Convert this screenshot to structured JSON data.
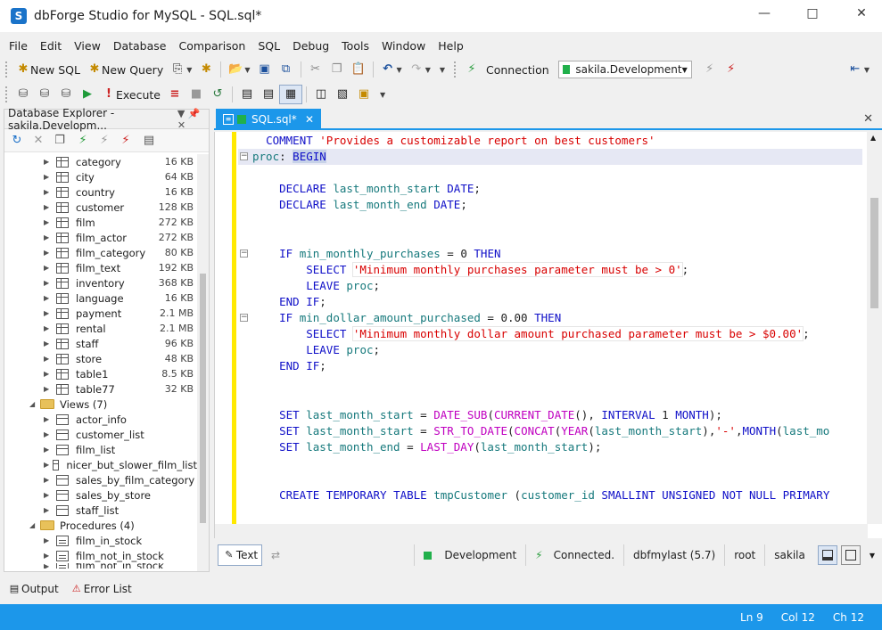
{
  "window": {
    "title": "dbForge Studio for MySQL - SQL.sql*",
    "logo": "S"
  },
  "menu": [
    "File",
    "Edit",
    "View",
    "Database",
    "Comparison",
    "SQL",
    "Debug",
    "Tools",
    "Window",
    "Help"
  ],
  "toolbar1": {
    "new_sql": "New SQL",
    "new_query": "New Query",
    "connection_label": "Connection",
    "connection_value": "sakila.Development"
  },
  "toolbar2": {
    "execute": "Execute"
  },
  "explorer": {
    "title": "Database Explorer - sakila.Developm...",
    "tables": [
      {
        "name": "category",
        "size": "16 KB"
      },
      {
        "name": "city",
        "size": "64 KB"
      },
      {
        "name": "country",
        "size": "16 KB"
      },
      {
        "name": "customer",
        "size": "128 KB"
      },
      {
        "name": "film",
        "size": "272 KB"
      },
      {
        "name": "film_actor",
        "size": "272 KB"
      },
      {
        "name": "film_category",
        "size": "80 KB"
      },
      {
        "name": "film_text",
        "size": "192 KB"
      },
      {
        "name": "inventory",
        "size": "368 KB"
      },
      {
        "name": "language",
        "size": "16 KB"
      },
      {
        "name": "payment",
        "size": "2.1 MB"
      },
      {
        "name": "rental",
        "size": "2.1 MB"
      },
      {
        "name": "staff",
        "size": "96 KB"
      },
      {
        "name": "store",
        "size": "48 KB"
      },
      {
        "name": "table1",
        "size": "8.5 KB"
      },
      {
        "name": "table77",
        "size": "32 KB"
      }
    ],
    "views_folder": "Views (7)",
    "views": [
      "actor_info",
      "customer_list",
      "film_list",
      "nicer_but_slower_film_list",
      "sales_by_film_category",
      "sales_by_store",
      "staff_list"
    ],
    "procedures_folder": "Procedures (4)",
    "procedures": [
      "film_in_stock",
      "film_not_in_stock"
    ]
  },
  "editor": {
    "tab_label": "SQL.sql*",
    "lines": [
      "  COMMENT 'Provides a customizable report on best customers'",
      "proc: BEGIN",
      "",
      "    DECLARE last_month_start DATE;",
      "    DECLARE last_month_end DATE;",
      "",
      "",
      "    IF min_monthly_purchases = 0 THEN",
      "        SELECT 'Minimum monthly purchases parameter must be > 0';",
      "        LEAVE proc;",
      "    END IF;",
      "    IF min_dollar_amount_purchased = 0.00 THEN",
      "        SELECT 'Minimum monthly dollar amount purchased parameter must be > $0.00';",
      "        LEAVE proc;",
      "    END IF;",
      "",
      "",
      "    SET last_month_start = DATE_SUB(CURRENT_DATE(), INTERVAL 1 MONTH);",
      "    SET last_month_start = STR_TO_DATE(CONCAT(YEAR(last_month_start),'-',MONTH(last_mo",
      "    SET last_month_end = LAST_DAY(last_month_start);",
      "",
      "",
      "    CREATE TEMPORARY TABLE tmpCustomer (customer_id SMALLINT UNSIGNED NOT NULL PRIMARY"
    ]
  },
  "editor_status": {
    "text_button": "Text",
    "environment": "Development",
    "connected": "Connected.",
    "server": "dbfmylast (5.7)",
    "user": "root",
    "database": "sakila"
  },
  "bottom_tabs": {
    "output": "Output",
    "error_list": "Error List"
  },
  "statusbar": {
    "ln": "Ln 9",
    "col": "Col 12",
    "ch": "Ch 12"
  },
  "colors": {
    "accent": "#1c97ea",
    "modified_bar": "#ffe900",
    "connected_green": "#21b04b"
  }
}
